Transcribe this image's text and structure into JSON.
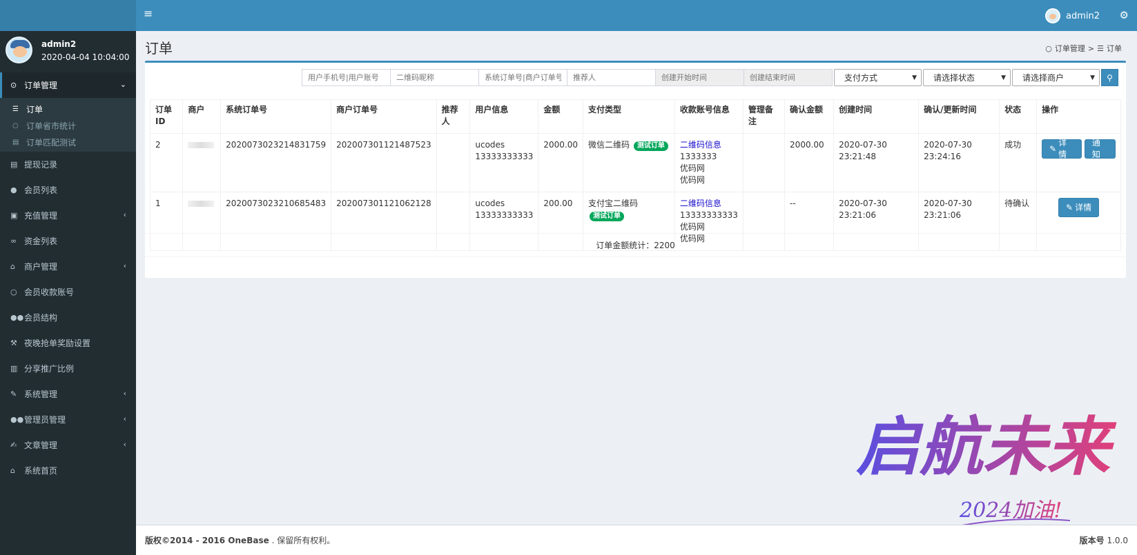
{
  "header": {
    "user_name": "admin2"
  },
  "sidebar": {
    "user": {
      "name": "admin2",
      "last_login": "2020-04-04 10:04:00"
    },
    "items": [
      {
        "label": "订单管理",
        "icon": "circle-dot-icon",
        "active": true
      },
      {
        "label": "提现记录",
        "icon": "list-icon"
      },
      {
        "label": "会员列表",
        "icon": "user-icon"
      },
      {
        "label": "充值管理",
        "icon": "image-icon"
      },
      {
        "label": "资金列表",
        "icon": "link-icon"
      },
      {
        "label": "商户管理",
        "icon": "bank-icon"
      },
      {
        "label": "会员收款账号",
        "icon": "circle-icon"
      },
      {
        "label": "会员结构",
        "icon": "users-icon"
      },
      {
        "label": "夜晚抢单奖励设置",
        "icon": "gavel-icon"
      },
      {
        "label": "分享推广比例",
        "icon": "linkedin-icon"
      },
      {
        "label": "系统管理",
        "icon": "wrench-icon"
      },
      {
        "label": "管理员管理",
        "icon": "users-icon"
      },
      {
        "label": "文章管理",
        "icon": "edit-icon"
      },
      {
        "label": "系统首页",
        "icon": "home-icon"
      }
    ],
    "submenu": [
      {
        "label": "订单",
        "active": true
      },
      {
        "label": "订单省市统计"
      },
      {
        "label": "订单匹配测试"
      }
    ]
  },
  "page": {
    "title": "订单",
    "breadcrumb": [
      "订单管理",
      "订单"
    ]
  },
  "filters": {
    "phone_placeholder": "用户手机号|用户账号",
    "qrcode_placeholder": "二维码昵称",
    "order_no_placeholder": "系统订单号|商户订单号",
    "referrer_placeholder": "推荐人",
    "start_time_placeholder": "创建开始时间",
    "end_time_placeholder": "创建结束时间",
    "pay_method": "支付方式",
    "status": "请选择状态",
    "merchant": "请选择商户"
  },
  "table": {
    "headers": [
      "订单ID",
      "商户",
      "系统订单号",
      "商户订单号",
      "推荐人",
      "用户信息",
      "金额",
      "支付类型",
      "收款账号信息",
      "管理备注",
      "确认金额",
      "创建时间",
      "确认/更新时间",
      "状态",
      "操作"
    ],
    "rows": [
      {
        "id": "2",
        "sys_order_no": "2020073023214831759",
        "merchant_order_no": "202007301121487523",
        "referrer": "",
        "user_name": "ucodes",
        "user_phone": "13333333333",
        "amount": "2000.00",
        "pay_type": "微信二维码",
        "tag": "测试订单",
        "account_link": "二维码信息",
        "account_line1": "1333333",
        "account_line2": "优码网",
        "account_line3": "优码网",
        "admin_note": "",
        "confirm_amount": "2000.00",
        "created_at": "2020-07-30 23:21:48",
        "updated_at": "2020-07-30 23:24:16",
        "status": "成功",
        "detail_label": "详情",
        "notify_label": "通知"
      },
      {
        "id": "1",
        "sys_order_no": "2020073023210685483",
        "merchant_order_no": "202007301121062128",
        "referrer": "",
        "user_name": "ucodes",
        "user_phone": "13333333333",
        "amount": "200.00",
        "pay_type": "支付宝二维码",
        "tag": "测试订单",
        "account_link": "二维码信息",
        "account_line1": "13333333333",
        "account_line2": "优码网",
        "account_line3": "优码网",
        "admin_note": "",
        "confirm_amount": "--",
        "created_at": "2020-07-30 23:21:06",
        "updated_at": "2020-07-30 23:21:06",
        "status": "待确认",
        "detail_label": "详情"
      }
    ]
  },
  "summary": {
    "text": "订单金额统计：2200"
  },
  "footer": {
    "copyright_bold": "版权©2014 - 2016 OneBase",
    "copyright_rest": ". 保留所有权利。",
    "version_label": "版本号",
    "version": "1.0.0"
  },
  "watermark": {
    "main": "启航未来",
    "sub": "2024加油!"
  },
  "colors": {
    "primary": "#3c8dbc",
    "sidebar": "#222d32",
    "success": "#00a65a"
  }
}
